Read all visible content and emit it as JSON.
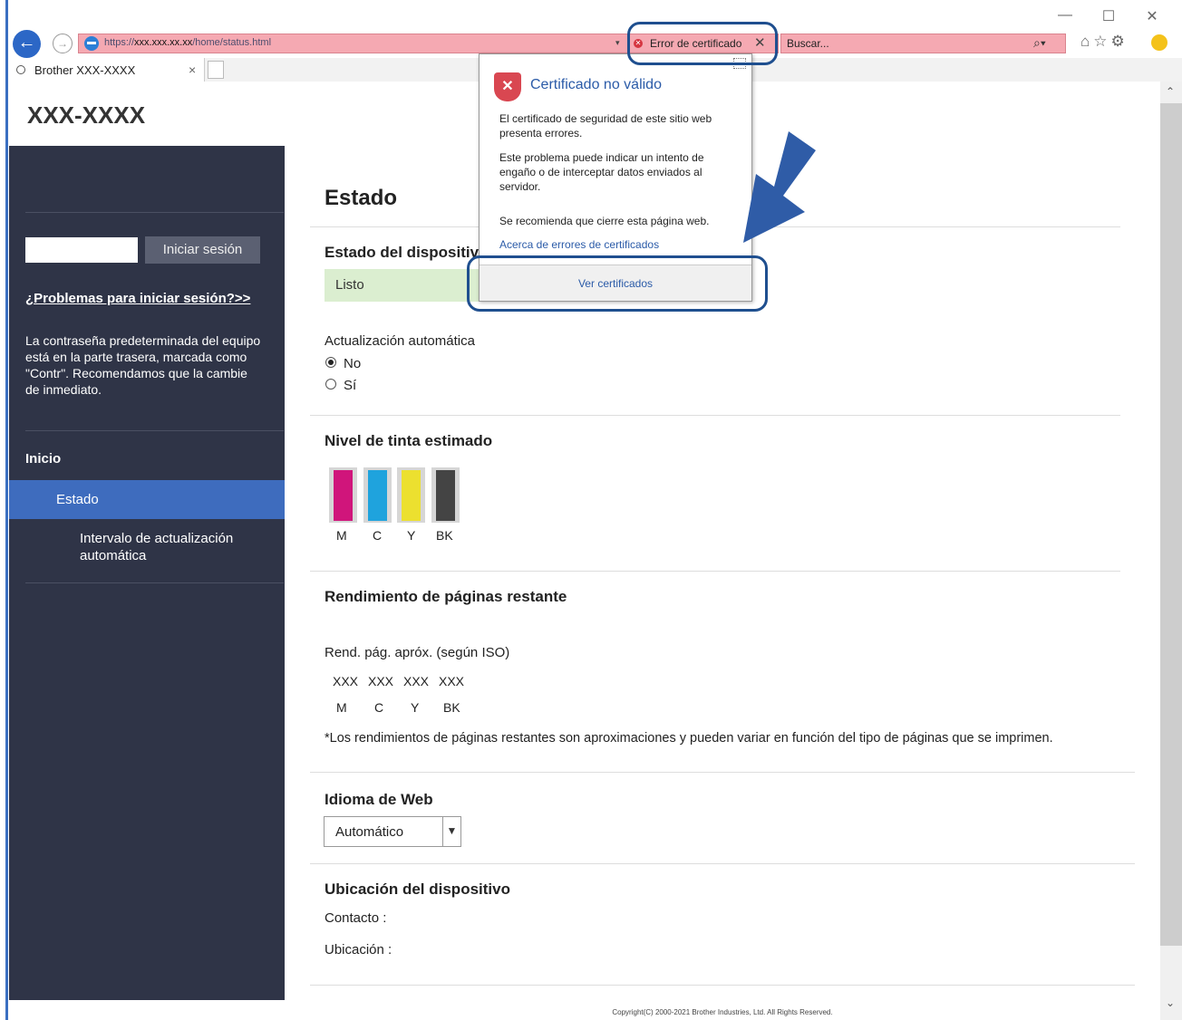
{
  "browser": {
    "url_prefix": "https://",
    "url_host": "xxx.xxx.xx.xx",
    "url_path": "/home/status.html",
    "cert_error_label": "Error de certificado",
    "search_placeholder": "Buscar...",
    "tab_title": "Brother XXX-XXXX"
  },
  "header": {
    "brand": "XXX-XXXX"
  },
  "popup": {
    "title": "Certificado no válido",
    "para1": "El certificado de seguridad de este sitio web presenta errores.",
    "para2": "Este problema puede indicar un intento de engaño o de interceptar datos enviados al servidor.",
    "para3": "Se recomienda que cierre esta página web.",
    "link": "Acerca de errores de certificados",
    "button": "Ver certificados"
  },
  "sidebar": {
    "login_button": "Iniciar sesión",
    "trouble_link": "¿Problemas para iniciar sesión?>>",
    "password_note": "La contraseña predeterminada del equipo está en la parte trasera, marcada como \"Contr\". Recomendamos que la cambie de inmediato.",
    "nav": {
      "home": "Inicio",
      "status": "Estado",
      "interval": "Intervalo de actualización automática"
    }
  },
  "main": {
    "title": "Estado",
    "device_status_heading": "Estado del dispositiv",
    "device_status_value": "Listo",
    "auto_update_label": "Actualización automática",
    "auto_update_options": [
      "No",
      "Sí"
    ],
    "auto_update_selected": "No",
    "ink_heading": "Nivel de tinta estimado",
    "ink": [
      {
        "label": "M",
        "color": "#d0157b"
      },
      {
        "label": "C",
        "color": "#1fa3dd"
      },
      {
        "label": "Y",
        "color": "#ece02f"
      },
      {
        "label": "BK",
        "color": "#444444"
      }
    ],
    "yield_heading": "Rendimiento de páginas restante",
    "yield_label": "Rend. pág. apróx. (según ISO)",
    "yield_values": [
      "XXX",
      "XXX",
      "XXX",
      "XXX"
    ],
    "yield_colors": [
      "M",
      "C",
      "Y",
      "BK"
    ],
    "yield_note": "*Los rendimientos de páginas restantes son aproximaciones y pueden variar en función del tipo de páginas que se imprimen.",
    "lang_heading": "Idioma de Web",
    "lang_value": "Automático",
    "location_heading": "Ubicación del dispositivo",
    "contact_label": "Contacto :",
    "location_label": "Ubicación :"
  },
  "footer": {
    "copyright": "Copyright(C) 2000-2021 Brother Industries, Ltd. All Rights Reserved."
  },
  "colors": {
    "sidebar": "#2f3447",
    "nav_active": "#3e6cbe",
    "address_error": "#f5a9b2",
    "highlight_ring": "#1f4f8f"
  }
}
